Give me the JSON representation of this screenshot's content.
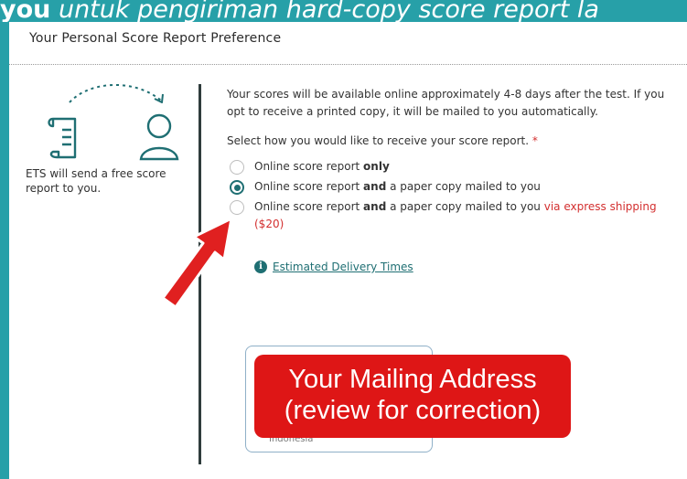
{
  "banner": {
    "bold_part": "you",
    "italic_part": " untuk pengiriman hard-copy score report la"
  },
  "frame_edge_letter": "a",
  "section": {
    "title": "Your Personal Score Report Preference"
  },
  "illustration": {
    "left_icon": "scroll-document-icon",
    "right_icon": "person-icon",
    "connector": "dashed-curved-arrow-icon",
    "side_note": "ETS will send a free score report to you."
  },
  "intro": "Your scores will be available online approximately 4-8 days after the test. If you opt to receive a printed copy, it will be mailed to you automatically.",
  "prompt": {
    "text": "Select how you would like to receive your score report. ",
    "required_marker": "*"
  },
  "options": [
    {
      "pre": "Online score report ",
      "bold": "only",
      "post": "",
      "extra": "",
      "checked": false
    },
    {
      "pre": "Online score report ",
      "bold": "and",
      "post": " a paper copy mailed to you",
      "extra": "",
      "checked": true
    },
    {
      "pre": "Online score report ",
      "bold": "and",
      "post": " a paper copy mailed to you ",
      "extra": "via express shipping ($20)",
      "checked": false
    }
  ],
  "info_link": {
    "icon": "info-icon",
    "label": "Estimated Delivery Times"
  },
  "address": {
    "partial_text": "Indonesia"
  },
  "overlay": {
    "line1": "Your Mailing Address",
    "line2": "(review for correction)"
  },
  "colors": {
    "teal_frame": "#27a0a8",
    "brand_teal": "#1f6f73",
    "overlay_red": "#de1616",
    "arrow_red": "#e02020",
    "required_red": "#d32f2f"
  }
}
